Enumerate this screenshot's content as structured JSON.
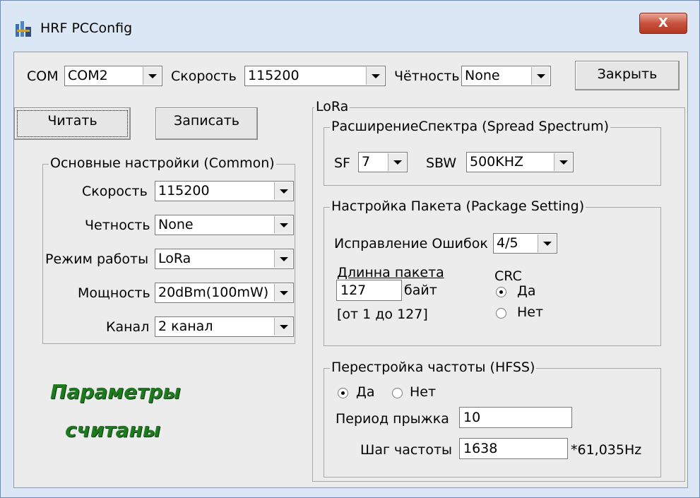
{
  "window": {
    "title": "HRF PCConfig",
    "close_label": "X"
  },
  "top_bar": {
    "com_label": "COM",
    "com_value": "COM2",
    "speed_label": "Скорость",
    "speed_value": "115200",
    "parity_label": "Чётность",
    "parity_value": "None",
    "close_button": "Закрыть"
  },
  "actions": {
    "read_button": "Читать",
    "write_button": "Записать"
  },
  "common": {
    "title": "Основные настройки (Common)",
    "speed_label": "Скорость",
    "speed_value": "115200",
    "parity_label": "Четность",
    "parity_value": "None",
    "mode_label": "Режим работы",
    "mode_value": "LoRa",
    "power_label": "Мощность",
    "power_value": "20dBm(100mW)",
    "channel_label": "Канал",
    "channel_value": "2 канал"
  },
  "status": {
    "line1": "Параметры",
    "line2": "считаны",
    "color": "#1e7a1e"
  },
  "lora": {
    "title": "LoRa",
    "spread": {
      "title": "РасширениеСпектра (Spread Spectrum)",
      "sf_label": "SF",
      "sf_value": "7",
      "sbw_label": "SBW",
      "sbw_value": "500KHZ"
    },
    "package": {
      "title": "Настройка Пакета (Package Setting)",
      "error_label": "Исправление Ошибок",
      "error_value": "4/5",
      "length_label": "Длинна пакета",
      "length_value": "127",
      "length_unit": "байт",
      "length_range": "[от 1 до 127]",
      "crc_label": "CRC",
      "crc_yes": "Да",
      "crc_no": "Нет",
      "crc_selected": "yes"
    },
    "hfss": {
      "title": "Перестройка частоты (HFSS)",
      "yes": "Да",
      "no": "Нет",
      "selected": "yes",
      "period_label": "Период прыжка",
      "period_value": "10",
      "step_label": "Шаг частоты",
      "step_value": "1638",
      "step_unit": "*61,035Hz"
    }
  }
}
